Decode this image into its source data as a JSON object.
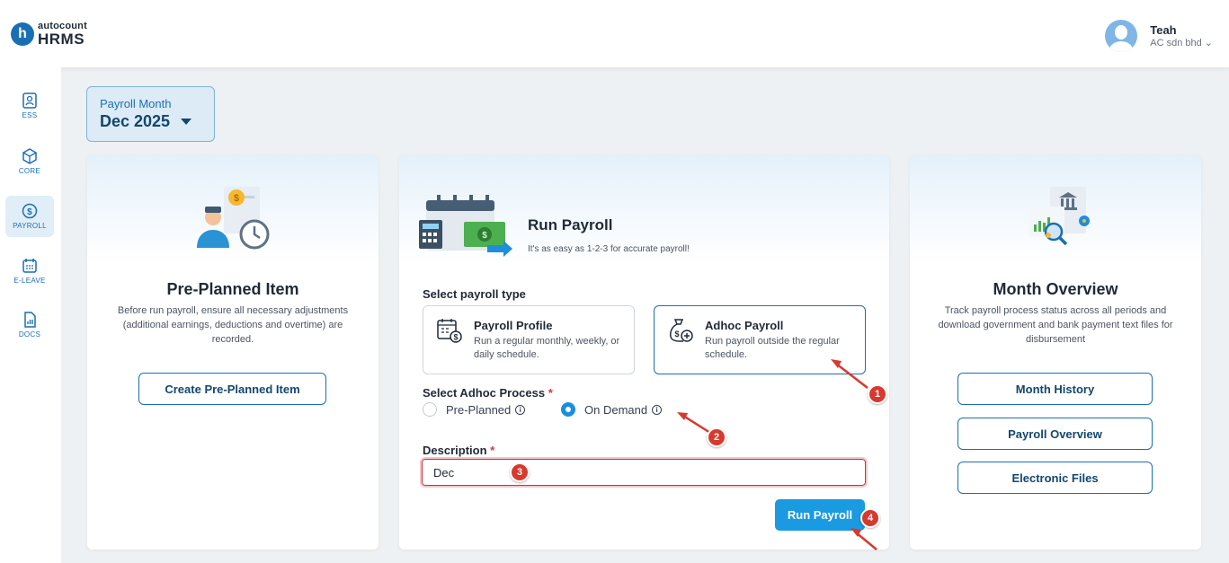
{
  "header": {
    "logo": {
      "letter": "h",
      "top": "autocount",
      "bottom": "HRMS"
    },
    "user": {
      "name": "Teah",
      "company": "AC sdn bhd ⌄"
    }
  },
  "sidebar": {
    "items": [
      {
        "label": "ESS",
        "icon": "ess-icon",
        "active": false
      },
      {
        "label": "CORE",
        "icon": "core-icon",
        "active": false
      },
      {
        "label": "PAYROLL",
        "icon": "payroll-icon",
        "active": true
      },
      {
        "label": "E-LEAVE",
        "icon": "calendar-icon",
        "active": false
      },
      {
        "label": "DOCS",
        "icon": "docs-icon",
        "active": false
      }
    ]
  },
  "payroll_month": {
    "label": "Payroll Month",
    "value": "Dec 2025"
  },
  "preplanned": {
    "title": "Pre-Planned Item",
    "description": "Before run payroll, ensure all necessary adjustments (additional earnings, deductions and overtime) are recorded.",
    "button": "Create Pre-Planned Item"
  },
  "run_payroll": {
    "title": "Run Payroll",
    "subtitle": "It's as easy as 1-2-3 for accurate payroll!",
    "type_label": "Select payroll type",
    "types": [
      {
        "title": "Payroll Profile",
        "desc": "Run a regular monthly, weekly, or daily schedule.",
        "selected": false
      },
      {
        "title": "Adhoc Payroll",
        "desc": "Run payroll outside the regular schedule.",
        "selected": true
      }
    ],
    "adhoc_label": "Select Adhoc Process",
    "adhoc_options": [
      {
        "label": "Pre-Planned",
        "selected": false
      },
      {
        "label": "On Demand",
        "selected": true
      }
    ],
    "description_label": "Description",
    "description_value": "Dec",
    "run_button": "Run Payroll",
    "required_mark": "*"
  },
  "overview": {
    "title": "Month Overview",
    "description": "Track payroll process status across all periods and download government and bank payment text files for disbursement",
    "buttons": [
      "Month History",
      "Payroll Overview",
      "Electronic Files"
    ]
  },
  "annotations": [
    "1",
    "2",
    "3",
    "4"
  ],
  "colors": {
    "accent": "#1a6fb4",
    "primary_button": "#1a9ae0",
    "marker": "#d63a2f"
  }
}
